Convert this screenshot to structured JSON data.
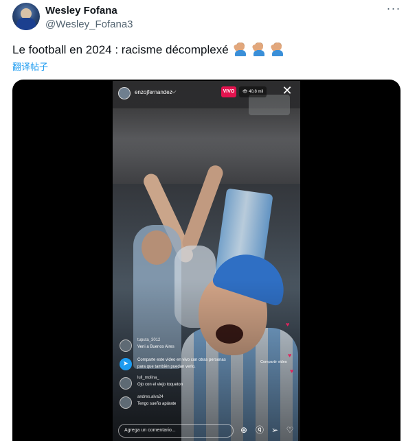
{
  "author": {
    "name": "Wesley Fofana",
    "handle": "@Wesley_Fofana3"
  },
  "more_icon": "···",
  "tweet_text": "Le football en 2024 : racisme décomplexé",
  "emoji_icon": "man-facepalming-emoji",
  "translate_link": "翻译帖子",
  "video": {
    "live_username": "enzojfernandez",
    "live_badge": "VIVO",
    "viewer_count": "40,8 mil",
    "close_icon": "✕",
    "comments": [
      {
        "user": "tuputa_3012",
        "text": "Veni a Buenos Aires"
      },
      {
        "user": "lull_molina_",
        "text": "Ojo con el viejo toqueton"
      },
      {
        "user": "andres.alva24",
        "text": "Tengo sueño apúrate"
      }
    ],
    "share_prompt_line1": "Comparte este video en vivo con otras personas",
    "share_prompt_line2": "para que también puedan verlo.",
    "share_side_label": "Compartir video",
    "comment_placeholder": "Agrega un comentario...",
    "bottom_icons": [
      "add-media-icon",
      "question-icon",
      "send-icon",
      "heart-icon"
    ]
  },
  "colors": {
    "link": "#1d9bf0",
    "live_red": "#e4134f",
    "secondary_text": "#536471"
  }
}
